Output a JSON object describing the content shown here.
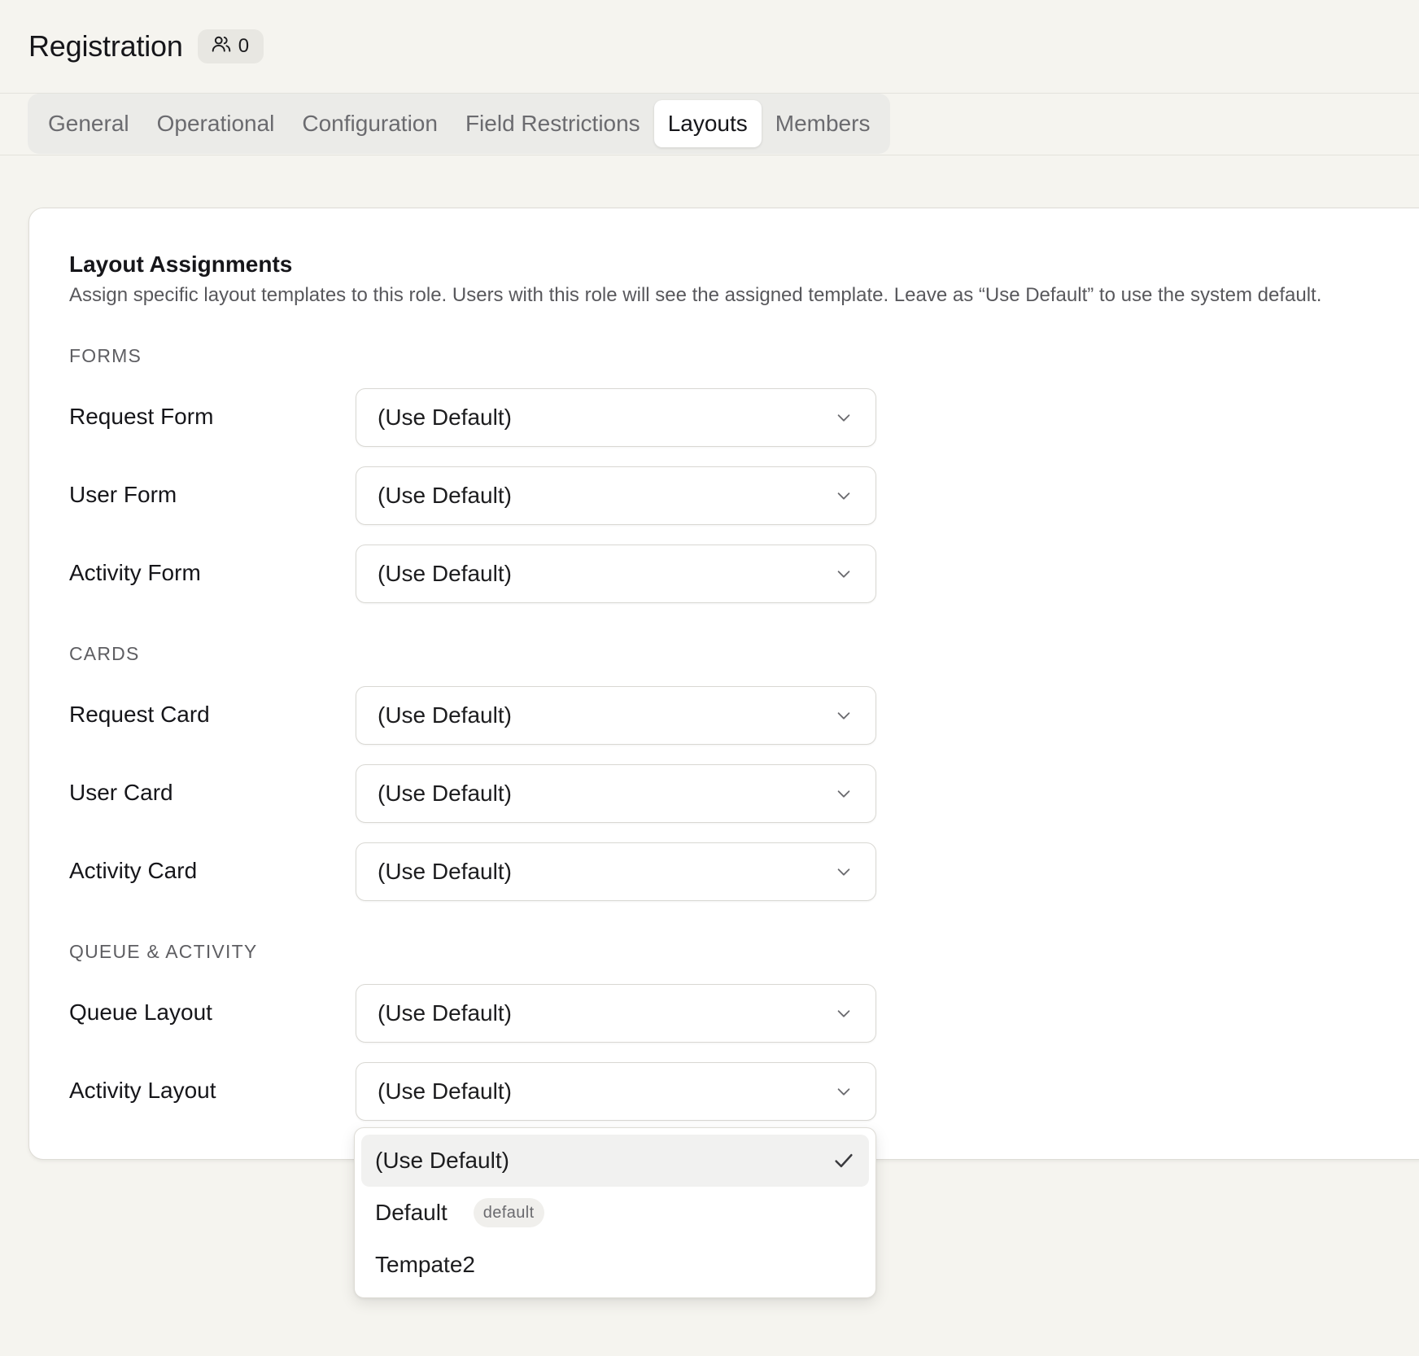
{
  "header": {
    "title": "Registration",
    "member_count": "0",
    "member_icon": "users-icon"
  },
  "tabs": [
    {
      "label": "General",
      "active": false
    },
    {
      "label": "Operational",
      "active": false
    },
    {
      "label": "Configuration",
      "active": false
    },
    {
      "label": "Field Restrictions",
      "active": false
    },
    {
      "label": "Layouts",
      "active": true
    },
    {
      "label": "Members",
      "active": false
    }
  ],
  "card": {
    "title": "Layout Assignments",
    "description": "Assign specific layout templates to this role. Users with this role will see the assigned template. Leave as “Use Default” to use the system default."
  },
  "sections": {
    "forms": {
      "label": "FORMS",
      "rows": [
        {
          "label": "Request Form",
          "value": "(Use Default)"
        },
        {
          "label": "User Form",
          "value": "(Use Default)"
        },
        {
          "label": "Activity Form",
          "value": "(Use Default)"
        }
      ]
    },
    "cards": {
      "label": "CARDS",
      "rows": [
        {
          "label": "Request Card",
          "value": "(Use Default)"
        },
        {
          "label": "User Card",
          "value": "(Use Default)"
        },
        {
          "label": "Activity Card",
          "value": "(Use Default)"
        }
      ]
    },
    "queue": {
      "label": "QUEUE & ACTIVITY",
      "rows": [
        {
          "label": "Queue Layout",
          "value": "(Use Default)"
        },
        {
          "label": "Activity Layout",
          "value": "(Use Default)"
        }
      ]
    }
  },
  "dropdown": {
    "options": [
      {
        "label": "(Use Default)",
        "selected": true,
        "badge": ""
      },
      {
        "label": "Default",
        "selected": false,
        "badge": "default"
      },
      {
        "label": "Tempate2",
        "selected": false,
        "badge": ""
      }
    ]
  },
  "colors": {
    "background": "#f5f4ef",
    "card": "#ffffff",
    "tab_bar": "#ebebe8",
    "text_primary": "#16161a",
    "text_muted": "#6b6b6f"
  }
}
